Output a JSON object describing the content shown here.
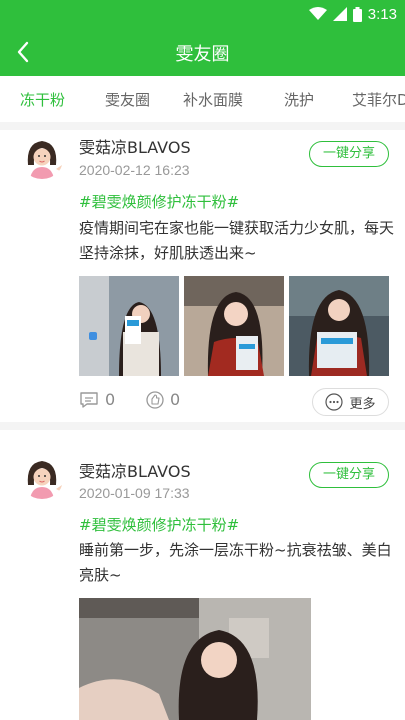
{
  "status_bar": {
    "time": "3:13"
  },
  "app_bar": {
    "title": "雯友圈"
  },
  "tabs": [
    {
      "label": "冻干粉",
      "active": true
    },
    {
      "label": "雯友圈",
      "active": false
    },
    {
      "label": "补水面膜",
      "active": false
    },
    {
      "label": "洗护",
      "active": false
    },
    {
      "label": "艾菲尔D",
      "active": false
    }
  ],
  "posts": [
    {
      "author": "雯菇凉BLAVOS",
      "date": "2020-02-12 16:23",
      "share_label": "一键分享",
      "tag": "#碧雯焕颜修护冻干粉#",
      "content": "疫情期间宅在家也能一键获取活力少女肌，每天坚持涂抹，好肌肤透出来~",
      "comments": "0",
      "likes": "0",
      "more_label": "更多"
    },
    {
      "author": "雯菇凉BLAVOS",
      "date": "2020-01-09 17:33",
      "share_label": "一键分享",
      "tag": "#碧雯焕颜修护冻干粉#",
      "content": "睡前第一步，先涂一层冻干粉~抗衰祛皱、美白亮肤~"
    }
  ],
  "colors": {
    "accent": "#2fbf3c",
    "muted": "#999999"
  }
}
